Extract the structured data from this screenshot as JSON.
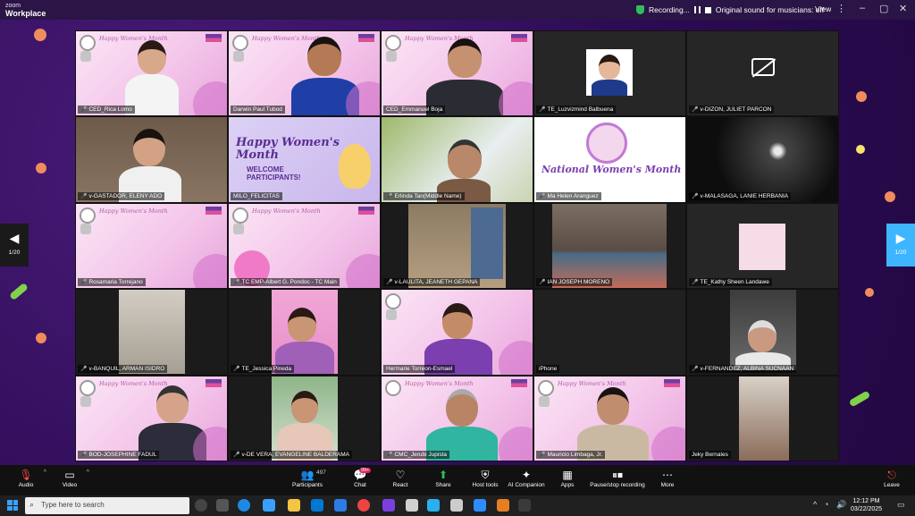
{
  "titlebar": {
    "brand_top": "zoom",
    "brand_main": "Workplace",
    "recording": "Recording...",
    "original_sound": "Original sound for musicians: off",
    "view": "View"
  },
  "nav": {
    "left_page": "1/20",
    "right_page": "1/20"
  },
  "tile_header_text": "Happy Women's Month",
  "slides": {
    "welcome_line1": "Happy Women's",
    "welcome_line2": "Month",
    "welcome_line3": "WELCOME",
    "welcome_line4": "PARTICIPANTS!",
    "national_title": "National Women's Month"
  },
  "participants": [
    {
      "name": "CED_Rica Lomo",
      "muted": true
    },
    {
      "name": "Darwin Paul Tubod",
      "muted": false
    },
    {
      "name": "CED_Emmanuel Boja",
      "muted": false
    },
    {
      "name": "TE_Luzvizmind Balbuena",
      "muted": true
    },
    {
      "name": "v-DIZON, JULIET PARCON",
      "muted": true
    },
    {
      "name": "v-GASTADOR, ELENY ADO",
      "muted": true
    },
    {
      "name": "MILO_FELICITAS",
      "muted": false
    },
    {
      "name": "Erlinda Tan(Middle Name)",
      "muted": true
    },
    {
      "name": "Ma Helen Aranguez",
      "muted": true
    },
    {
      "name": "v-MALASAGA, LANIE HERBANIA",
      "muted": true
    },
    {
      "name": "Rosamaria Torrejano",
      "muted": true
    },
    {
      "name": "TC EMP-Albert G. Pondoc - TC Main",
      "muted": true
    },
    {
      "name": "v-LAULITA, JEANETH GEPANA",
      "muted": true
    },
    {
      "name": "IAN JOSEPH MORENO",
      "muted": true
    },
    {
      "name": "TE_Kathy Sheen Landawe",
      "muted": true
    },
    {
      "name": "v-BANQUIL, ARMAN ISIDRO",
      "muted": true
    },
    {
      "name": "TE_Jessica Pineda",
      "muted": true
    },
    {
      "name": "Hermarie Torreon-Esmael",
      "muted": false
    },
    {
      "name": "iPhone",
      "muted": false
    },
    {
      "name": "v-FERNANDEZ, ALBINA SUCNAAN",
      "muted": true
    },
    {
      "name": "BOD-JOSEPHINE FADUL",
      "muted": true
    },
    {
      "name": "v-DE VERA, EVANGELINE BALDERAMA",
      "muted": true
    },
    {
      "name": "CMC_Jerubi Jupista",
      "muted": true
    },
    {
      "name": "Mauricio Limbaga, Jr.",
      "muted": true
    },
    {
      "name": "Jeky Bernales",
      "muted": false
    }
  ],
  "toolbar": {
    "audio": "Audio",
    "video": "Video",
    "participants": "Participants",
    "participants_count": "497",
    "chat": "Chat",
    "chat_badge": "99+",
    "react": "React",
    "share": "Share",
    "host_tools": "Host tools",
    "ai_companion": "AI Companion",
    "apps": "Apps",
    "pause_stop": "Pause/stop recording",
    "more": "More",
    "leave": "Leave"
  },
  "taskbar": {
    "search_placeholder": "Type here to search",
    "time": "12:12 PM",
    "date": "03/22/2025"
  },
  "colors": {
    "accent_blue": "#3db6ff",
    "brand_pink": "#e04f9b",
    "share_green": "#2fbf5a"
  }
}
